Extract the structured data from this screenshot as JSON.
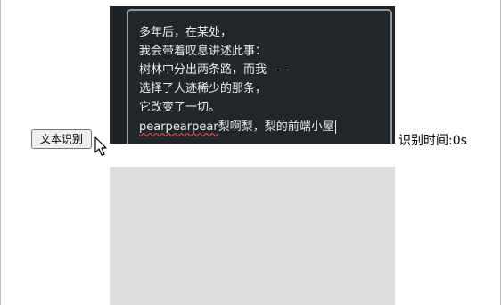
{
  "poem": {
    "lines": [
      "多年后，在某处，",
      "我会带着叹息讲述此事：",
      "树林中分出两条路，而我——",
      "选择了人迹稀少的那条，",
      "它改变了一切。"
    ],
    "last_line_underlined": "pearpearpear",
    "last_line_rest": "梨啊梨，梨的前端小屋"
  },
  "controls": {
    "ocr_button_label": "文本识别",
    "time_label": "识别时间:0s"
  },
  "icons": {
    "cursor": "mouse-pointer-icon"
  },
  "colors": {
    "image_background": "#1f2224",
    "result_area": "#dcdedd",
    "text_box_border": "#8e9a9c"
  }
}
